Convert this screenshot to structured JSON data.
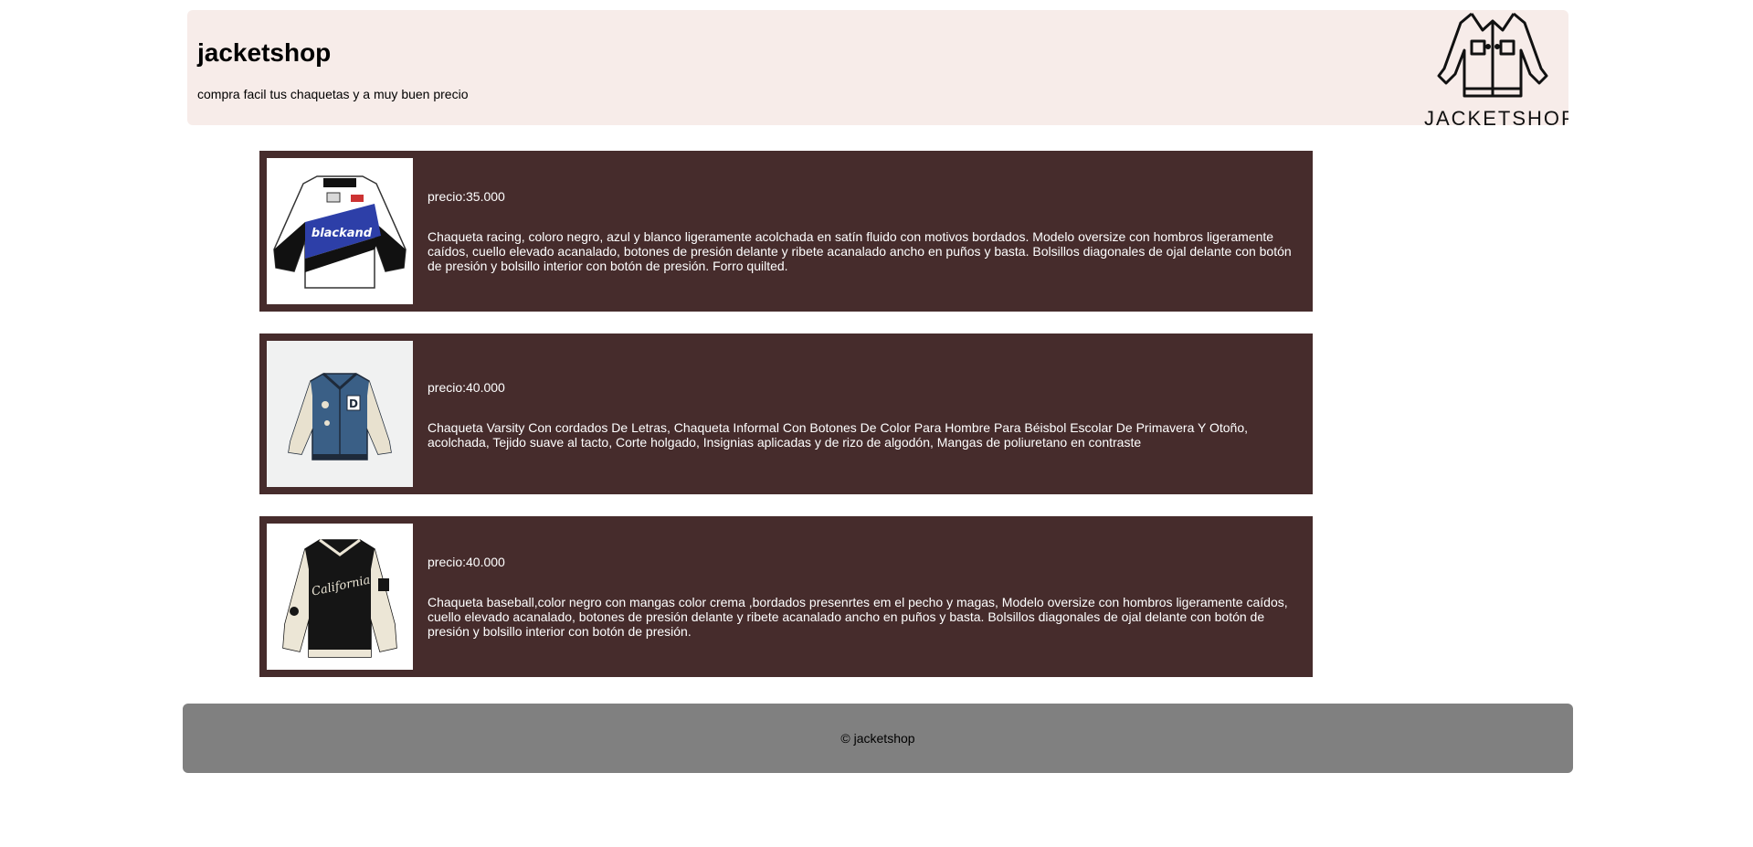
{
  "header": {
    "title": "jacketshop",
    "tagline": "compra facil tus chaquetas y a muy buen precio",
    "logo_text": "JACKETSHOP"
  },
  "products": [
    {
      "price": "precio:35.000",
      "description": "Chaqueta racing, coloro negro, azul y blanco ligeramente acolchada en satín fluido con motivos bordados. Modelo oversize con hombros ligeramente caídos, cuello elevado acanalado, botones de presión delante y ribete acanalado ancho en puños y basta. Bolsillos diagonales de ojal delante con botón de presión y bolsillo interior con botón de presión. Forro quilted.",
      "image_label": "blackand",
      "colors": {
        "body": "#2d3fa8",
        "sleeves": "#111111",
        "trim": "#ffffff"
      }
    },
    {
      "price": "precio:40.000",
      "description": "Chaqueta Varsity Con cordados De Letras, Chaqueta Informal Con Botones De Color Para Hombre Para Béisbol Escolar De Primavera Y Otoño, acolchada, Tejido suave al tacto, Corte holgado, Insignias aplicadas y de rizo de algodón, Mangas de poliuretano en contraste",
      "image_label": "D",
      "colors": {
        "body": "#3a5f86",
        "sleeves": "#e8e1cf",
        "trim": "#1e2a3a"
      }
    },
    {
      "price": "precio:40.000",
      "description": "Chaqueta baseball,color negro con mangas color crema ,bordados presenrtes em el pecho y magas, Modelo oversize con hombros ligeramente caídos, cuello elevado acanalado, botones de presión delante y ribete acanalado ancho en puños y basta. Bolsillos diagonales de ojal delante con botón de presión y bolsillo interior con botón de presión.",
      "image_label": "California",
      "colors": {
        "body": "#151515",
        "sleeves": "#ece6d6",
        "trim": "#1a1a1a"
      }
    }
  ],
  "footer": {
    "text": "© jacketshop"
  }
}
